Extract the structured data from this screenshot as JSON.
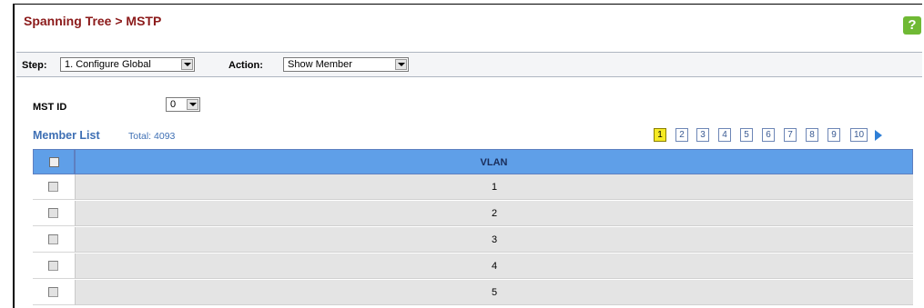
{
  "header": {
    "title": "Spanning Tree > MSTP",
    "help_glyph": "?"
  },
  "step_bar": {
    "step_label": "Step:",
    "step_value": "1. Configure Global",
    "action_label": "Action:",
    "action_value": "Show Member"
  },
  "mst": {
    "label": "MST ID",
    "value": "0"
  },
  "member_list": {
    "heading": "Member List",
    "total": "Total: 4093"
  },
  "pager": {
    "pages": [
      "1",
      "2",
      "3",
      "4",
      "5",
      "6",
      "7",
      "8",
      "9",
      "10"
    ],
    "current": "1"
  },
  "table": {
    "columns": [
      "",
      "VLAN"
    ],
    "rows": [
      {
        "vlan": "1"
      },
      {
        "vlan": "2"
      },
      {
        "vlan": "3"
      },
      {
        "vlan": "4"
      },
      {
        "vlan": "5"
      }
    ]
  },
  "colors": {
    "title": "#8b1a1a",
    "accent": "#3e6fb4",
    "table_header": "#5f9fe8",
    "help": "#6fb934",
    "current_page": "#f5ea25"
  }
}
